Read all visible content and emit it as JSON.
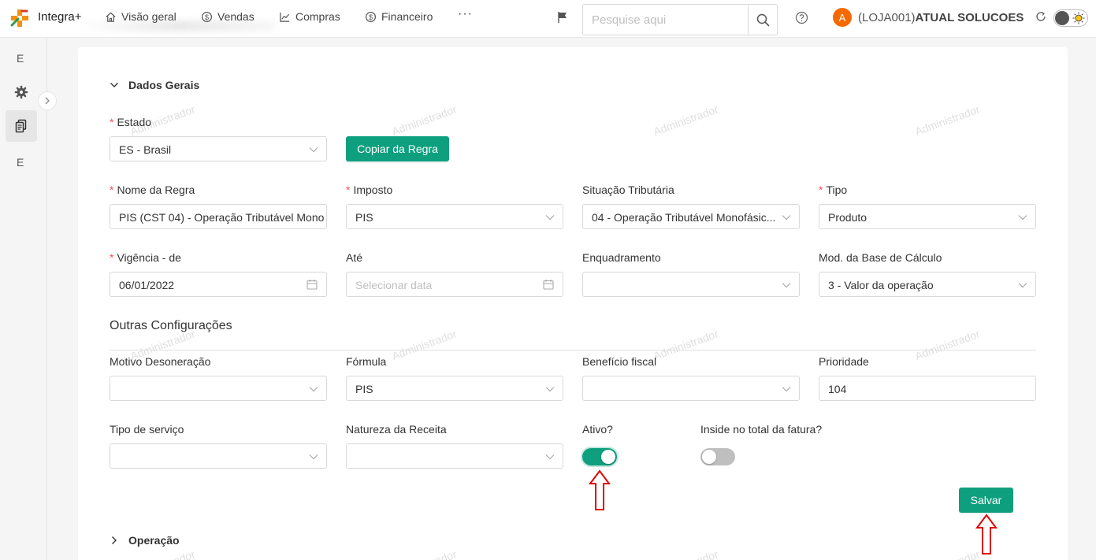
{
  "app": {
    "brand": "Integra+",
    "nav": [
      {
        "label": "Visão geral",
        "icon": "home-icon"
      },
      {
        "label": "Vendas",
        "icon": "dollar-circle-icon"
      },
      {
        "label": "Compras",
        "icon": "line-chart-icon"
      },
      {
        "label": "Financeiro",
        "icon": "dollar-circle-icon"
      }
    ],
    "more": "···",
    "search_placeholder": "Pesquise aqui",
    "avatar_letter": "A",
    "user_prefix": "(LOJA001)",
    "user_name": "ATUAL SOLUCOES"
  },
  "sidebar": {
    "top_letter": "E",
    "bottom_letter": "E"
  },
  "form": {
    "section_dados": "Dados Gerais",
    "estado_label": "Estado",
    "estado_value": "ES - Brasil",
    "copy_button": "Copiar da Regra",
    "nome_label": "Nome da Regra",
    "nome_value": "PIS (CST 04) - Operação Tributável Mono",
    "imposto_label": "Imposto",
    "imposto_value": "PIS",
    "situacao_label": "Situação Tributária",
    "situacao_value": "04 - Operação Tributável Monofásic...",
    "tipo_label": "Tipo",
    "tipo_value": "Produto",
    "vigencia_label": "Vigência - de",
    "vigencia_value": "06/01/2022",
    "ate_label": "Até",
    "ate_placeholder": "Selecionar data",
    "enquadramento_label": "Enquadramento",
    "mod_base_label": "Mod. da Base de Cálculo",
    "mod_base_value": "3 - Valor da operação",
    "section_outras": "Outras Configurações",
    "motivo_label": "Motivo Desoneração",
    "formula_label": "Fórmula",
    "formula_value": "PIS",
    "beneficio_label": "Benefício fiscal",
    "prioridade_label": "Prioridade",
    "prioridade_value": "104",
    "tipo_servico_label": "Tipo de serviço",
    "natureza_label": "Natureza da Receita",
    "ativo_label": "Ativo?",
    "ativo_on": true,
    "inside_label": "Inside no total da fatura?",
    "inside_on": false,
    "save_button": "Salvar",
    "section_operacao": "Operação"
  },
  "watermark": "Administrador",
  "colors": {
    "primary": "#0e9f7e",
    "required": "#ff4d4f",
    "avatar": "#f56a00",
    "annotation": "#e00000"
  }
}
